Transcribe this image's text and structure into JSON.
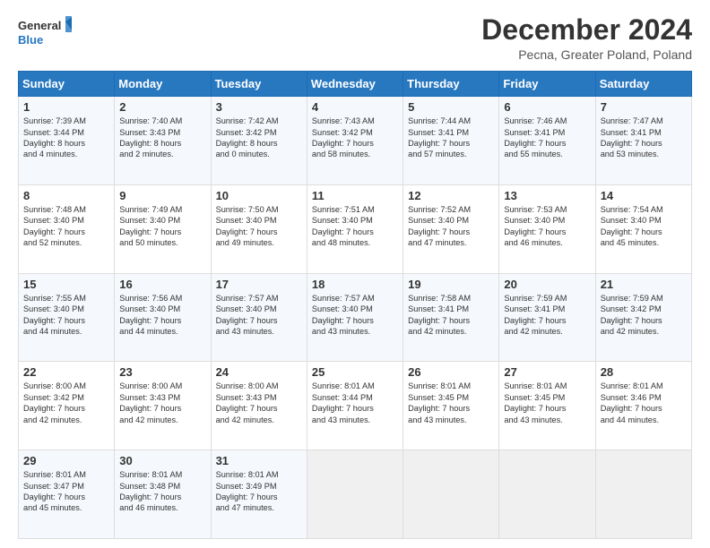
{
  "logo": {
    "line1": "General",
    "line2": "Blue"
  },
  "title": "December 2024",
  "subtitle": "Pecna, Greater Poland, Poland",
  "days_of_week": [
    "Sunday",
    "Monday",
    "Tuesday",
    "Wednesday",
    "Thursday",
    "Friday",
    "Saturday"
  ],
  "weeks": [
    [
      {
        "day": 1,
        "lines": [
          "Sunrise: 7:39 AM",
          "Sunset: 3:44 PM",
          "Daylight: 8 hours",
          "and 4 minutes."
        ]
      },
      {
        "day": 2,
        "lines": [
          "Sunrise: 7:40 AM",
          "Sunset: 3:43 PM",
          "Daylight: 8 hours",
          "and 2 minutes."
        ]
      },
      {
        "day": 3,
        "lines": [
          "Sunrise: 7:42 AM",
          "Sunset: 3:42 PM",
          "Daylight: 8 hours",
          "and 0 minutes."
        ]
      },
      {
        "day": 4,
        "lines": [
          "Sunrise: 7:43 AM",
          "Sunset: 3:42 PM",
          "Daylight: 7 hours",
          "and 58 minutes."
        ]
      },
      {
        "day": 5,
        "lines": [
          "Sunrise: 7:44 AM",
          "Sunset: 3:41 PM",
          "Daylight: 7 hours",
          "and 57 minutes."
        ]
      },
      {
        "day": 6,
        "lines": [
          "Sunrise: 7:46 AM",
          "Sunset: 3:41 PM",
          "Daylight: 7 hours",
          "and 55 minutes."
        ]
      },
      {
        "day": 7,
        "lines": [
          "Sunrise: 7:47 AM",
          "Sunset: 3:41 PM",
          "Daylight: 7 hours",
          "and 53 minutes."
        ]
      }
    ],
    [
      {
        "day": 8,
        "lines": [
          "Sunrise: 7:48 AM",
          "Sunset: 3:40 PM",
          "Daylight: 7 hours",
          "and 52 minutes."
        ]
      },
      {
        "day": 9,
        "lines": [
          "Sunrise: 7:49 AM",
          "Sunset: 3:40 PM",
          "Daylight: 7 hours",
          "and 50 minutes."
        ]
      },
      {
        "day": 10,
        "lines": [
          "Sunrise: 7:50 AM",
          "Sunset: 3:40 PM",
          "Daylight: 7 hours",
          "and 49 minutes."
        ]
      },
      {
        "day": 11,
        "lines": [
          "Sunrise: 7:51 AM",
          "Sunset: 3:40 PM",
          "Daylight: 7 hours",
          "and 48 minutes."
        ]
      },
      {
        "day": 12,
        "lines": [
          "Sunrise: 7:52 AM",
          "Sunset: 3:40 PM",
          "Daylight: 7 hours",
          "and 47 minutes."
        ]
      },
      {
        "day": 13,
        "lines": [
          "Sunrise: 7:53 AM",
          "Sunset: 3:40 PM",
          "Daylight: 7 hours",
          "and 46 minutes."
        ]
      },
      {
        "day": 14,
        "lines": [
          "Sunrise: 7:54 AM",
          "Sunset: 3:40 PM",
          "Daylight: 7 hours",
          "and 45 minutes."
        ]
      }
    ],
    [
      {
        "day": 15,
        "lines": [
          "Sunrise: 7:55 AM",
          "Sunset: 3:40 PM",
          "Daylight: 7 hours",
          "and 44 minutes."
        ]
      },
      {
        "day": 16,
        "lines": [
          "Sunrise: 7:56 AM",
          "Sunset: 3:40 PM",
          "Daylight: 7 hours",
          "and 44 minutes."
        ]
      },
      {
        "day": 17,
        "lines": [
          "Sunrise: 7:57 AM",
          "Sunset: 3:40 PM",
          "Daylight: 7 hours",
          "and 43 minutes."
        ]
      },
      {
        "day": 18,
        "lines": [
          "Sunrise: 7:57 AM",
          "Sunset: 3:40 PM",
          "Daylight: 7 hours",
          "and 43 minutes."
        ]
      },
      {
        "day": 19,
        "lines": [
          "Sunrise: 7:58 AM",
          "Sunset: 3:41 PM",
          "Daylight: 7 hours",
          "and 42 minutes."
        ]
      },
      {
        "day": 20,
        "lines": [
          "Sunrise: 7:59 AM",
          "Sunset: 3:41 PM",
          "Daylight: 7 hours",
          "and 42 minutes."
        ]
      },
      {
        "day": 21,
        "lines": [
          "Sunrise: 7:59 AM",
          "Sunset: 3:42 PM",
          "Daylight: 7 hours",
          "and 42 minutes."
        ]
      }
    ],
    [
      {
        "day": 22,
        "lines": [
          "Sunrise: 8:00 AM",
          "Sunset: 3:42 PM",
          "Daylight: 7 hours",
          "and 42 minutes."
        ]
      },
      {
        "day": 23,
        "lines": [
          "Sunrise: 8:00 AM",
          "Sunset: 3:43 PM",
          "Daylight: 7 hours",
          "and 42 minutes."
        ]
      },
      {
        "day": 24,
        "lines": [
          "Sunrise: 8:00 AM",
          "Sunset: 3:43 PM",
          "Daylight: 7 hours",
          "and 42 minutes."
        ]
      },
      {
        "day": 25,
        "lines": [
          "Sunrise: 8:01 AM",
          "Sunset: 3:44 PM",
          "Daylight: 7 hours",
          "and 43 minutes."
        ]
      },
      {
        "day": 26,
        "lines": [
          "Sunrise: 8:01 AM",
          "Sunset: 3:45 PM",
          "Daylight: 7 hours",
          "and 43 minutes."
        ]
      },
      {
        "day": 27,
        "lines": [
          "Sunrise: 8:01 AM",
          "Sunset: 3:45 PM",
          "Daylight: 7 hours",
          "and 43 minutes."
        ]
      },
      {
        "day": 28,
        "lines": [
          "Sunrise: 8:01 AM",
          "Sunset: 3:46 PM",
          "Daylight: 7 hours",
          "and 44 minutes."
        ]
      }
    ],
    [
      {
        "day": 29,
        "lines": [
          "Sunrise: 8:01 AM",
          "Sunset: 3:47 PM",
          "Daylight: 7 hours",
          "and 45 minutes."
        ]
      },
      {
        "day": 30,
        "lines": [
          "Sunrise: 8:01 AM",
          "Sunset: 3:48 PM",
          "Daylight: 7 hours",
          "and 46 minutes."
        ]
      },
      {
        "day": 31,
        "lines": [
          "Sunrise: 8:01 AM",
          "Sunset: 3:49 PM",
          "Daylight: 7 hours",
          "and 47 minutes."
        ]
      },
      null,
      null,
      null,
      null
    ]
  ]
}
